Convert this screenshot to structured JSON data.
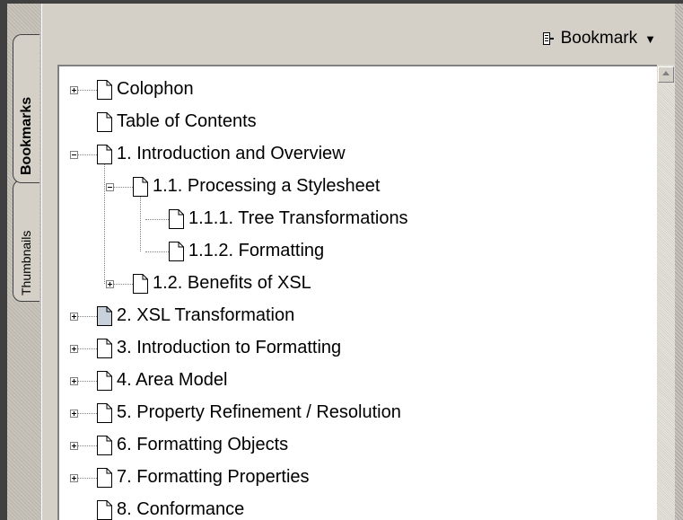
{
  "tabs": {
    "bookmarks": "Bookmarks",
    "thumbnails": "Thumbnails"
  },
  "toolbar": {
    "bookmark_label": "Bookmark",
    "caret": "▼"
  },
  "tree": [
    {
      "label": "Colophon",
      "level": 0,
      "expander": "plus"
    },
    {
      "label": "Table of Contents",
      "level": 0,
      "expander": "none"
    },
    {
      "label": "1. Introduction and Overview",
      "level": 0,
      "expander": "minus"
    },
    {
      "label": "1.1. Processing a Stylesheet",
      "level": 1,
      "expander": "minus"
    },
    {
      "label": "1.1.1. Tree Transformations",
      "level": 2,
      "expander": "none"
    },
    {
      "label": "1.1.2. Formatting",
      "level": 2,
      "expander": "none"
    },
    {
      "label": "1.2. Benefits of XSL",
      "level": 1,
      "expander": "plus"
    },
    {
      "label": "2. XSL Transformation",
      "level": 0,
      "expander": "plus",
      "selected_icon": true
    },
    {
      "label": "3. Introduction to Formatting",
      "level": 0,
      "expander": "plus"
    },
    {
      "label": "4. Area Model",
      "level": 0,
      "expander": "plus"
    },
    {
      "label": "5. Property Refinement / Resolution",
      "level": 0,
      "expander": "plus"
    },
    {
      "label": "6. Formatting Objects",
      "level": 0,
      "expander": "plus"
    },
    {
      "label": "7. Formatting Properties",
      "level": 0,
      "expander": "plus"
    },
    {
      "label": "8. Conformance",
      "level": 0,
      "expander": "none"
    }
  ],
  "icons": {
    "page": "page-icon",
    "toolbar": "bookmark-options-icon",
    "scroll": "scroll-up-arrow-icon"
  }
}
